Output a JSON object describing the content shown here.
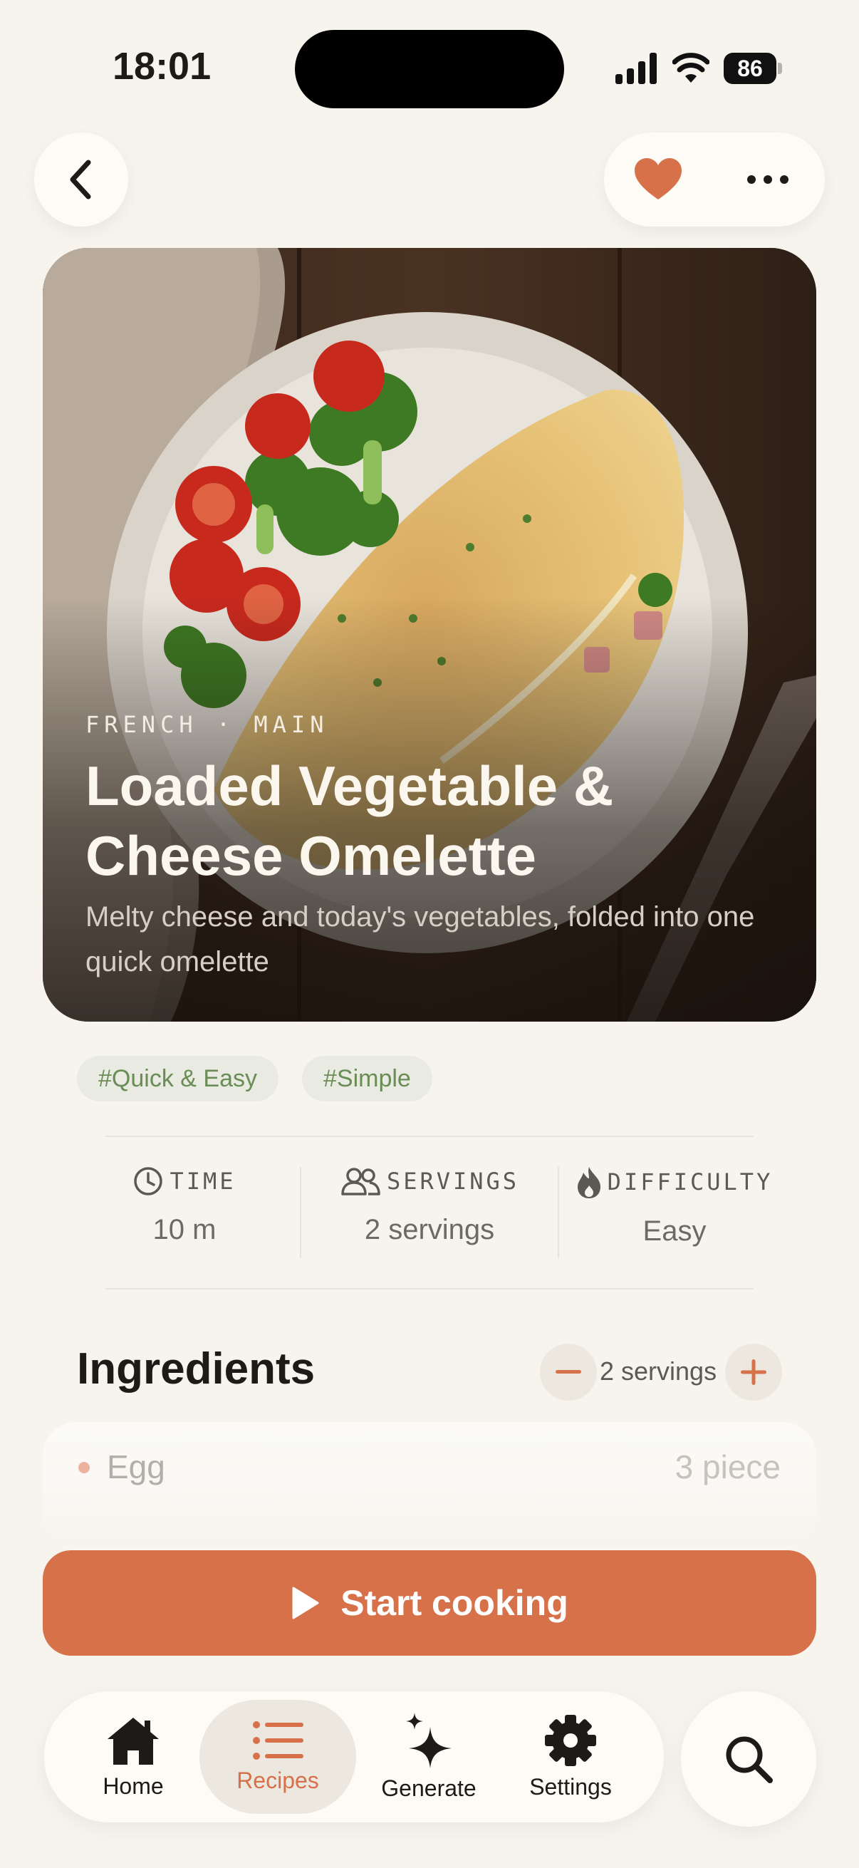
{
  "status_bar": {
    "time": "18:01",
    "battery": "86"
  },
  "header": {
    "back_icon": "chevron-left-icon",
    "favorite_icon": "heart-icon",
    "more_icon": "ellipsis-icon",
    "accent_color": "#d6714a"
  },
  "recipe": {
    "category": "FRENCH · MAIN",
    "title": "Loaded Vegetable & Cheese Omelette",
    "subtitle": "Melty cheese and today's vegetables, folded into one quick omelette",
    "tags": [
      "#Quick & Easy",
      "#Simple"
    ]
  },
  "stats": {
    "time": {
      "label": "TIME",
      "value": "10 m",
      "icon": "clock-icon"
    },
    "servings": {
      "label": "SERVINGS",
      "value": "2 servings",
      "icon": "people-icon"
    },
    "difficulty": {
      "label": "DIFFICULTY",
      "value": "Easy",
      "icon": "flame-icon"
    }
  },
  "ingredients": {
    "title": "Ingredients",
    "servings_label": "2 servings",
    "items": [
      {
        "name": "Egg",
        "quantity": "3 piece"
      }
    ]
  },
  "actions": {
    "start_label": "Start cooking"
  },
  "tabbar": {
    "tabs": [
      {
        "label": "Home",
        "icon": "house-icon"
      },
      {
        "label": "Recipes",
        "icon": "list-icon",
        "active": true
      },
      {
        "label": "Generate",
        "icon": "sparkle-icon"
      },
      {
        "label": "Settings",
        "icon": "gear-icon"
      }
    ],
    "search_icon": "search-icon"
  }
}
